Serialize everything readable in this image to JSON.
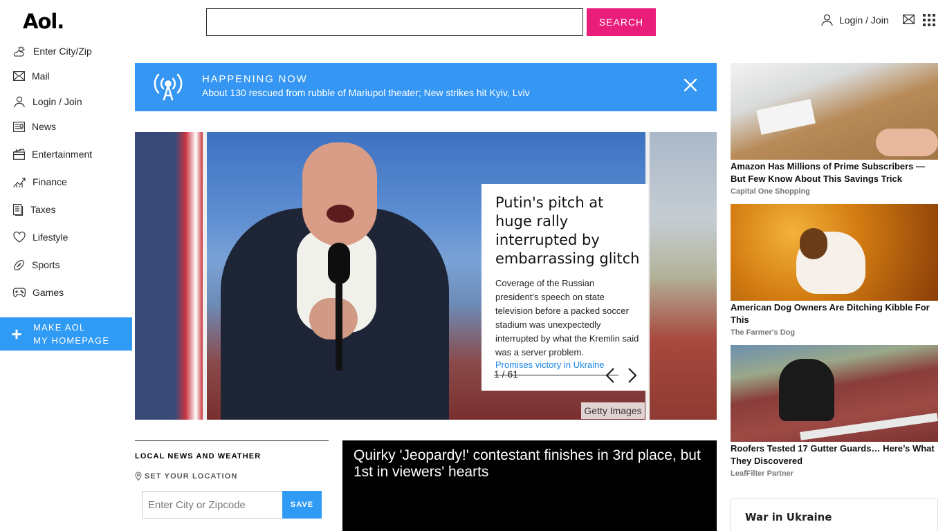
{
  "header": {
    "logo": "Aol.",
    "search_placeholder": "",
    "search_button": "SEARCH",
    "login_label": "Login / Join"
  },
  "sidebar": {
    "items": [
      {
        "label": "Enter City/Zip",
        "icon": "weather-icon"
      },
      {
        "label": "Mail",
        "icon": "mail-icon"
      },
      {
        "label": "Login / Join",
        "icon": "user-icon"
      },
      {
        "label": "News",
        "icon": "news-icon"
      },
      {
        "label": "Entertainment",
        "icon": "clapperboard-icon"
      },
      {
        "label": "Finance",
        "icon": "chart-icon"
      },
      {
        "label": "Taxes",
        "icon": "document-icon"
      },
      {
        "label": "Lifestyle",
        "icon": "heart-icon"
      },
      {
        "label": "Sports",
        "icon": "football-icon"
      },
      {
        "label": "Games",
        "icon": "gamepad-icon"
      }
    ],
    "make_homepage_line1": "MAKE AOL",
    "make_homepage_line2": "MY HOMEPAGE"
  },
  "happening_now": {
    "title": "HAPPENING NOW",
    "text": "About 130 rescued from rubble of Mariupol theater; New strikes hit Kyiv, Lviv"
  },
  "carousel": {
    "headline": "Putin's pitch at huge rally interrupted by embarrassing glitch",
    "summary": "Coverage of the Russian president's speech on state television before a packed soccer stadium was unexpectedly interrupted by what the Kremlin said was a server problem.",
    "link": "Promises victory in Ukraine",
    "counter": "1 / 61",
    "credit": "Getty Images"
  },
  "local_news": {
    "heading": "LOCAL NEWS AND WEATHER",
    "set_location": "SET YOUR LOCATION",
    "zip_placeholder": "Enter City or Zipcode",
    "save": "SAVE"
  },
  "video": {
    "title": "Quirky 'Jeopardy!' contestant finishes in 3rd place, but 1st in viewers' hearts"
  },
  "ads": [
    {
      "headline": "Amazon Has Millions of Prime Subscribers — But Few Know About This Savings Trick",
      "sponsor": "Capital One Shopping"
    },
    {
      "headline": "American Dog Owners Are Ditching Kibble For This",
      "sponsor": "The Farmer's Dog"
    },
    {
      "headline": "Roofers Tested 17 Gutter Guards… Here’s What They Discovered",
      "sponsor": "LeafFilter Partner"
    }
  ],
  "war_module": {
    "title": "War in Ukraine"
  },
  "colors": {
    "search_button": "#e91e7b",
    "accent_blue": "#2f9bf4",
    "happening_blue": "#3597f3",
    "link_blue": "#1e88e5"
  }
}
